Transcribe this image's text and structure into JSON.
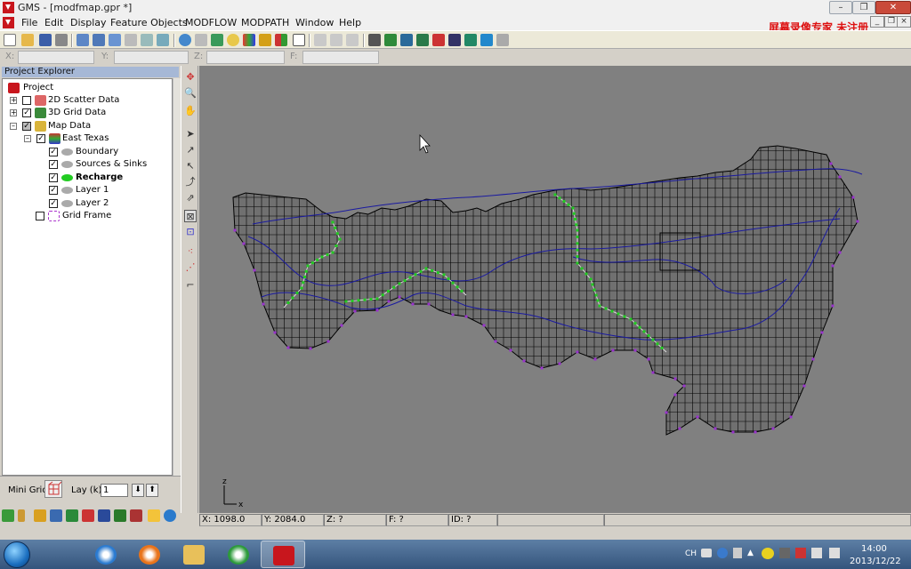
{
  "window": {
    "title": "GMS - [modfmap.gpr *]",
    "watermark": "屏幕录像专家 未注册"
  },
  "menu": {
    "items": [
      "File",
      "Edit",
      "Display",
      "Feature Objects",
      "MODFLOW",
      "MODPATH",
      "Window",
      "Help"
    ]
  },
  "coords": {
    "x_label": "X:",
    "y_label": "Y:",
    "z_label": "Z:",
    "f_label": "F:"
  },
  "explorer": {
    "title": "Project Explorer",
    "tree": {
      "project": "Project",
      "scatter": "2D Scatter Data",
      "grid3d": "3D Grid Data",
      "map": "Map Data",
      "coverage": "East Texas",
      "boundary": "Boundary",
      "sources": "Sources & Sinks",
      "recharge": "Recharge",
      "layer1": "Layer 1",
      "layer2": "Layer 2",
      "gridframe": "Grid Frame"
    }
  },
  "minigrid": {
    "label": "Mini Grid:",
    "lay_label": "Lay (k):",
    "lay_value": "1"
  },
  "status": {
    "x": "X: 1098.0",
    "y": "Y: 2084.0",
    "z": "Z: ?",
    "f": "F: ?",
    "id": "ID: ?"
  },
  "axis_triad": {
    "x": "x",
    "z": "z"
  },
  "taskbar": {
    "lang": "CH",
    "time": "14:00",
    "date": "2013/12/22"
  },
  "colors": {
    "accent": "#c8161d",
    "grid_fill": "#6f6f6f",
    "contour": "#1a1aa0",
    "arc": "#000000",
    "stream": "#22cc22",
    "well": "#9933cc"
  }
}
